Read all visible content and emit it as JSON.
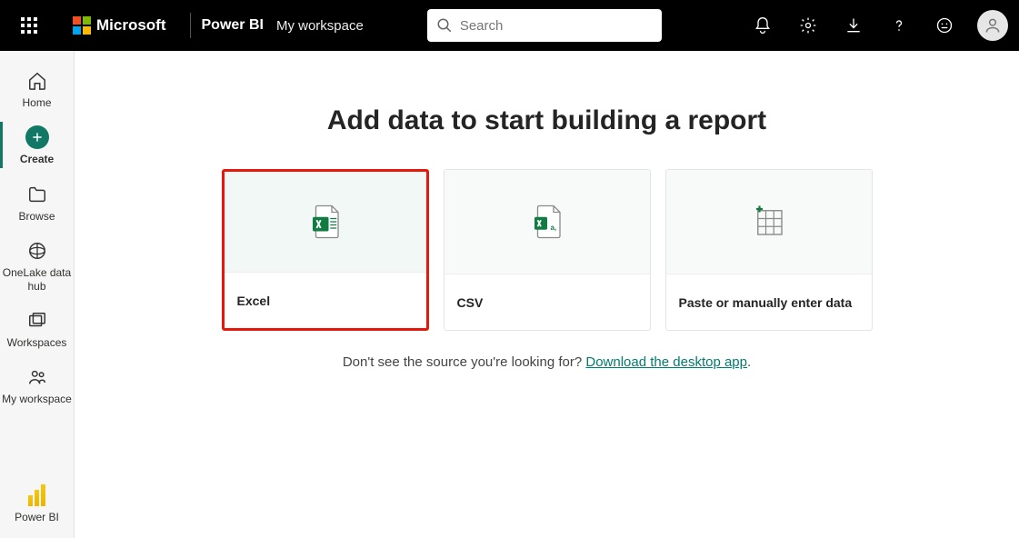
{
  "header": {
    "brand": "Microsoft",
    "product": "Power BI",
    "workspace": "My workspace",
    "search_placeholder": "Search"
  },
  "sidebar": {
    "items": [
      {
        "label": "Home",
        "icon": "home",
        "active": false
      },
      {
        "label": "Create",
        "icon": "create",
        "active": true
      },
      {
        "label": "Browse",
        "icon": "browse",
        "active": false
      },
      {
        "label": "OneLake data hub",
        "icon": "onelake",
        "active": false
      },
      {
        "label": "Workspaces",
        "icon": "workspaces",
        "active": false
      },
      {
        "label": "My workspace",
        "icon": "people",
        "active": false
      }
    ],
    "footer_label": "Power BI"
  },
  "main": {
    "title": "Add data to start building a report",
    "cards": [
      {
        "label": "Excel",
        "highlight": true
      },
      {
        "label": "CSV",
        "highlight": false
      },
      {
        "label": "Paste or manually enter data",
        "highlight": false
      }
    ],
    "hint_prefix": "Don't see the source you're looking for? ",
    "hint_link": "Download the desktop app",
    "hint_suffix": "."
  }
}
